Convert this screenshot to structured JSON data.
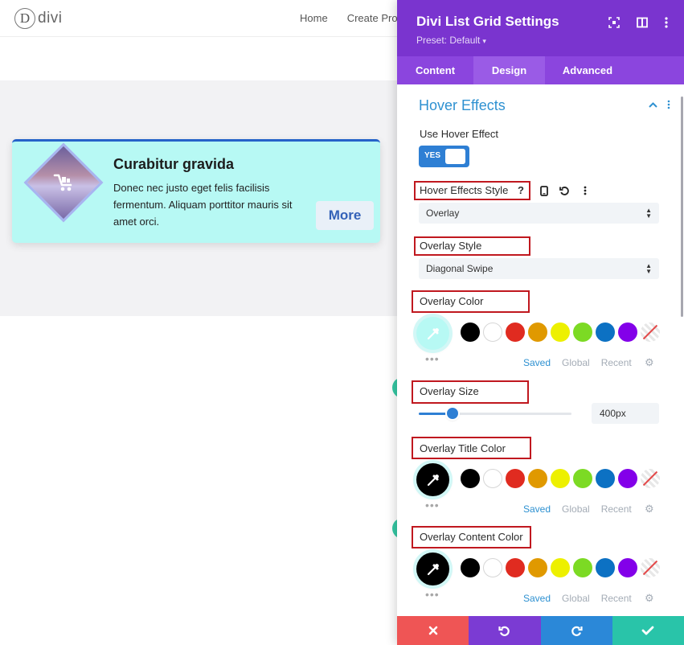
{
  "site": {
    "logo_letter": "D",
    "logo_text": "divi",
    "nav": [
      "Home",
      "Create Pro"
    ],
    "card": {
      "title": "Curabitur gravida",
      "text": "Donec nec justo eget felis facilisis fermentum. Aliquam porttitor mauris sit amet orci.",
      "button": "More",
      "icon": "cart-icon"
    }
  },
  "panel": {
    "title": "Divi List Grid Settings",
    "preset": "Preset: Default",
    "header_icons": [
      "expand-icon",
      "sidebar-icon",
      "more-icon"
    ],
    "tabs": [
      {
        "label": "Content",
        "active": false
      },
      {
        "label": "Design",
        "active": true
      },
      {
        "label": "Advanced",
        "active": false
      }
    ],
    "section": {
      "title": "Hover Effects",
      "use_hover_label": "Use Hover Effect",
      "toggle_value": "YES",
      "hover_style_label": "Hover Effects Style",
      "help_glyph": "?",
      "hover_style_value": "Overlay",
      "overlay_style_label": "Overlay Style",
      "overlay_style_value": "Diagonal Swipe",
      "overlay_color_label": "Overlay Color",
      "overlay_size_label": "Overlay Size",
      "overlay_size_value": "400px",
      "overlay_size_fraction": 0.22,
      "overlay_title_color_label": "Overlay Title Color",
      "overlay_content_color_label": "Overlay Content Color"
    },
    "palette": {
      "swatches": [
        "#000000",
        "#ffffff",
        "#e02b20",
        "#e09900",
        "#edf000",
        "#7cda24",
        "#0c71c3",
        "#8300e9"
      ],
      "tabs": [
        "Saved",
        "Global",
        "Recent"
      ],
      "active_tab": "Saved",
      "more": "•••"
    },
    "pickers": {
      "overlay_color": "#b7f9f4",
      "overlay_title_color": "#000000",
      "overlay_content_color": "#000000"
    }
  },
  "footer": [
    {
      "name": "discard",
      "icon": "close-icon",
      "color": "#ef5555"
    },
    {
      "name": "undo",
      "icon": "undo-icon",
      "color": "#7b3bd3"
    },
    {
      "name": "redo",
      "icon": "redo-icon",
      "color": "#2b88d8"
    },
    {
      "name": "save",
      "icon": "check-icon",
      "color": "#29c4a9"
    }
  ],
  "colors": {
    "header": "#7a34cf",
    "tabs": "#8b45de",
    "accent": "#2e91d1",
    "highlight_box": "#c0181f",
    "card_bg": "#b7f9f4"
  }
}
